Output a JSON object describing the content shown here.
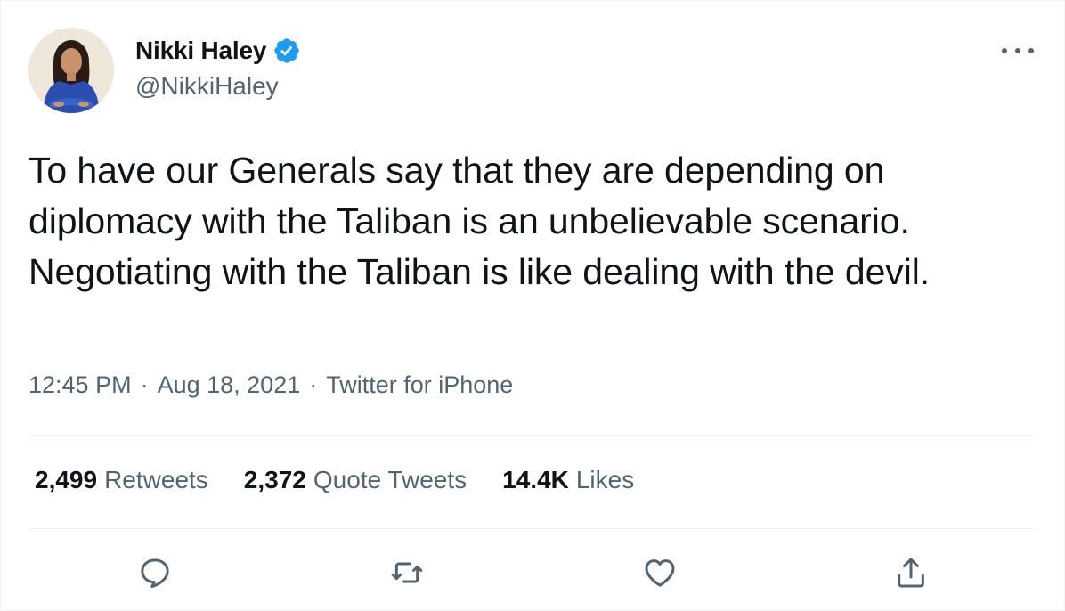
{
  "author": {
    "display_name": "Nikki Haley",
    "handle": "@NikkiHaley",
    "verified": true,
    "avatar_icon": "profile-photo"
  },
  "tweet": {
    "text": "To have our Generals say that they are depending on diplomacy with the Taliban is an unbelievable scenario. Negotiating with the Taliban is like dealing with the devil.",
    "time": "12:45 PM",
    "date": "Aug 18, 2021",
    "separator": "·",
    "source": "Twitter for iPhone"
  },
  "stats": [
    {
      "count": "2,499",
      "label": "Retweets"
    },
    {
      "count": "2,372",
      "label": "Quote Tweets"
    },
    {
      "count": "14.4K",
      "label": "Likes"
    }
  ],
  "actions": [
    {
      "icon": "reply-icon"
    },
    {
      "icon": "retweet-icon"
    },
    {
      "icon": "like-icon"
    },
    {
      "icon": "share-icon"
    }
  ],
  "more_icon": "more-icon",
  "colors": {
    "text_primary": "#0f1419",
    "text_secondary": "#536471",
    "verified_blue": "#1d9bf0",
    "divider": "#eff3f4"
  }
}
